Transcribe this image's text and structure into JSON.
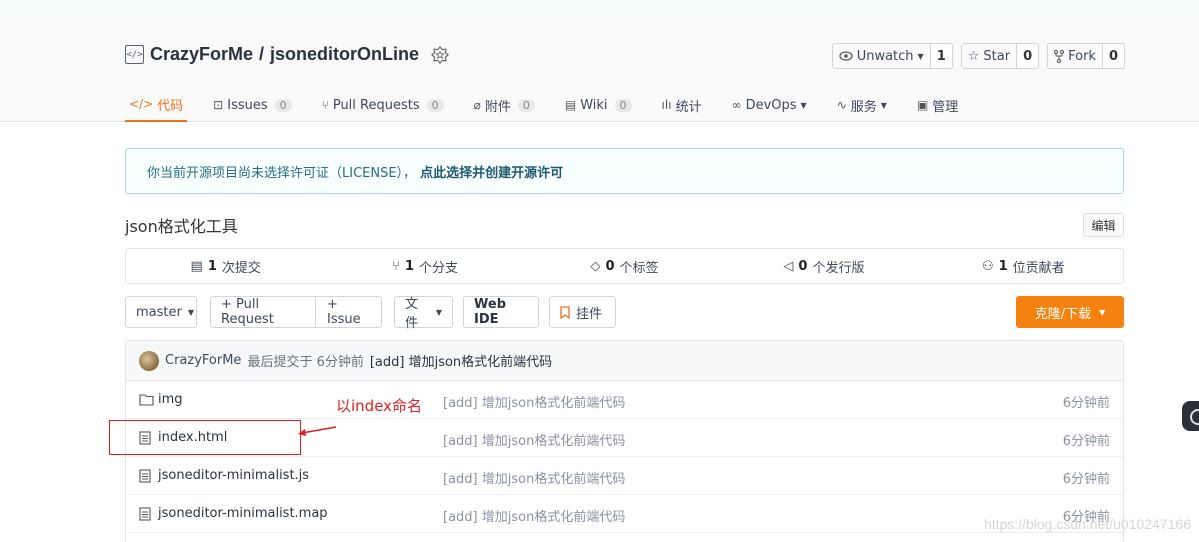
{
  "repo": {
    "owner": "CrazyForMe",
    "separator": "/",
    "name": "jsoneditorOnLine"
  },
  "actions": [
    {
      "label": "Unwatch",
      "count": "1"
    },
    {
      "label": "Star",
      "count": "0"
    },
    {
      "label": "Fork",
      "count": "0"
    }
  ],
  "tabs": [
    {
      "label": "代码",
      "count": ""
    },
    {
      "label": "Issues",
      "count": "0"
    },
    {
      "label": "Pull Requests",
      "count": "0"
    },
    {
      "label": "附件",
      "count": "0"
    },
    {
      "label": "Wiki",
      "count": "0"
    },
    {
      "label": "统计",
      "count": ""
    },
    {
      "label": "DevOps",
      "count": ""
    },
    {
      "label": "服务",
      "count": ""
    },
    {
      "label": "管理",
      "count": ""
    }
  ],
  "notice": {
    "text": "你当前开源项目尚未选择许可证（LICENSE），",
    "link": "点此选择并创建开源许可"
  },
  "description": "json格式化工具",
  "edit_label": "编辑",
  "stats": [
    {
      "num": "1",
      "label": "次提交"
    },
    {
      "num": "1",
      "label": "个分支"
    },
    {
      "num": "0",
      "label": "个标签"
    },
    {
      "num": "0",
      "label": "个发行版"
    },
    {
      "num": "1",
      "label": "位贡献者"
    }
  ],
  "toolbar": {
    "branch": "master",
    "pull_request": "+ Pull Request",
    "issue": "+ Issue",
    "files": "文件",
    "web_ide": "Web IDE",
    "widget": "挂件",
    "clone": "克隆/下载"
  },
  "last_commit": {
    "author": "CrazyForMe",
    "text": "最后提交于 6分钟前",
    "message": "[add] 增加json格式化前端代码"
  },
  "files": [
    {
      "name": "img",
      "type": "folder",
      "message": "[add] 增加json格式化前端代码",
      "time": "6分钟前"
    },
    {
      "name": "index.html",
      "type": "file",
      "message": "[add] 增加json格式化前端代码",
      "time": "6分钟前"
    },
    {
      "name": "jsoneditor-minimalist.js",
      "type": "file",
      "message": "[add] 增加json格式化前端代码",
      "time": "6分钟前"
    },
    {
      "name": "jsoneditor-minimalist.map",
      "type": "file",
      "message": "[add] 增加json格式化前端代码",
      "time": "6分钟前"
    }
  ],
  "annotation": {
    "text": "以index命名",
    "color": "#e02020"
  },
  "watermark": "https://blog.csdn.net/u010247166",
  "colors": {
    "accent": "#f2711c",
    "clone_button": "#f5820f",
    "notice_text": "#276f86"
  }
}
